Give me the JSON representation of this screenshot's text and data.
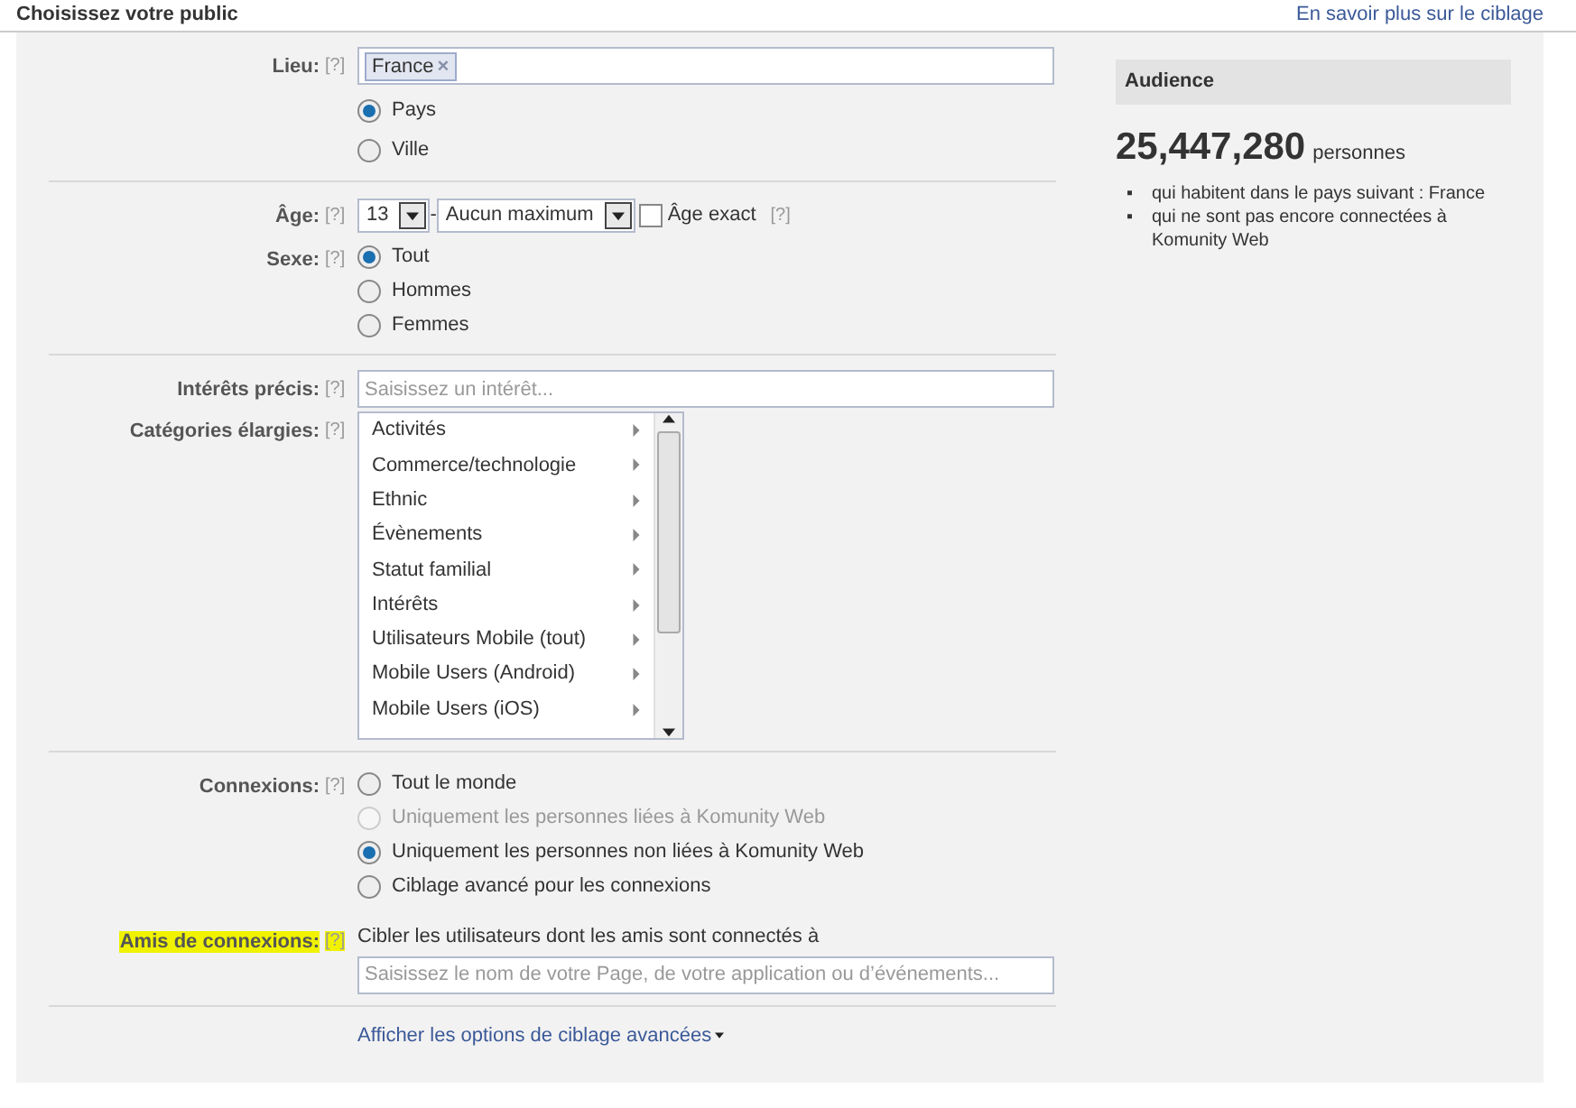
{
  "header": {
    "title": "Choisissez votre public",
    "link": "En savoir plus sur le ciblage"
  },
  "sections": [
    {
      "rows": [
        {
          "kind": "tokens",
          "label": "Lieu:",
          "help": "[?]",
          "tokens": [
            {
              "text": "France",
              "remove": "×"
            }
          ]
        },
        {
          "kind": "radios",
          "spaced": true,
          "options": [
            {
              "label": "Pays",
              "selected": true,
              "disabled": false
            },
            {
              "label": "Ville",
              "selected": false,
              "disabled": false
            }
          ]
        }
      ]
    },
    {
      "rows": [
        {
          "kind": "age",
          "label": "Âge:",
          "help": "[?]",
          "min": "13",
          "separator": "-",
          "max": "Aucun maximum",
          "exact": {
            "label": "Âge exact",
            "checked": false,
            "help": "[?]"
          }
        },
        {
          "kind": "radios",
          "label": "Sexe:",
          "help": "[?]",
          "spaced": false,
          "options": [
            {
              "label": "Tout",
              "selected": true,
              "disabled": false
            },
            {
              "label": "Hommes",
              "selected": false,
              "disabled": false
            },
            {
              "label": "Femmes",
              "selected": false,
              "disabled": false
            }
          ]
        }
      ]
    },
    {
      "rows": [
        {
          "kind": "text_input",
          "label": "Intérêts précis:",
          "help": "[?]",
          "placeholder": "Saisissez un intérêt..."
        },
        {
          "kind": "list",
          "label": "Catégories élargies:",
          "help": "[?]",
          "items": [
            "Activités",
            "Commerce/technologie",
            "Ethnic",
            "Évènements",
            "Statut familial",
            "Intérêts",
            "Utilisateurs Mobile (tout)",
            "Mobile Users (Android)",
            "Mobile Users (iOS)"
          ]
        }
      ]
    },
    {
      "rows": [
        {
          "kind": "radios",
          "label": "Connexions:",
          "help": "[?]",
          "spaced": false,
          "options": [
            {
              "label": "Tout le monde",
              "selected": false,
              "disabled": false
            },
            {
              "label": "Uniquement les personnes liées à Komunity Web",
              "selected": false,
              "disabled": true
            },
            {
              "label": "Uniquement les personnes non liées à Komunity Web",
              "selected": true,
              "disabled": false
            },
            {
              "label": "Ciblage avancé pour les connexions",
              "selected": false,
              "disabled": false
            }
          ]
        },
        {
          "kind": "note_input",
          "label": "Amis de connexions:",
          "help": "[?]",
          "highlighted": true,
          "note": "Cibler les utilisateurs dont les amis sont connectés à",
          "placeholder": "Saisissez le nom de votre Page, de votre application ou d’événements..."
        }
      ]
    }
  ],
  "footer_link": "Afficher les options de ciblage avancées",
  "audience": {
    "title": "Audience",
    "count": "25,447,280",
    "unit": "personnes",
    "bullets": [
      {
        "marker": "▪",
        "text": "qui habitent dans le pays suivant : France"
      },
      {
        "marker": "▪",
        "text": "qui ne sont pas encore connectées à Komunity Web"
      }
    ]
  }
}
